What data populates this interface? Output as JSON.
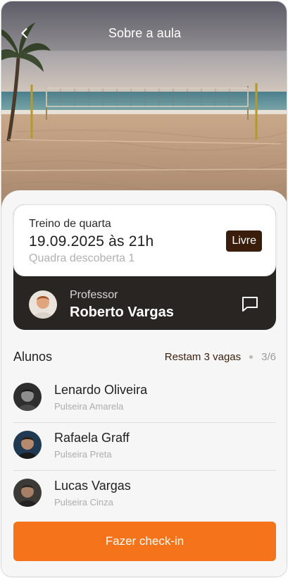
{
  "header": {
    "title": "Sobre a aula",
    "back_icon": "chevron-left-icon"
  },
  "hero_image": "beach-volleyball-court",
  "class_info": {
    "name": "Treino de quarta",
    "datetime": "19.09.2025 às 21h",
    "location": "Quadra descoberta 1",
    "badge": "Livre"
  },
  "professor": {
    "label": "Professor",
    "name": "Roberto Vargas",
    "chat_icon": "chat-icon"
  },
  "students": {
    "title": "Alunos",
    "remaining": "Restam 3 vagas",
    "count": "3/6",
    "items": [
      {
        "name": "Lenardo Oliveira",
        "belt": "Pulseira Amarela"
      },
      {
        "name": "Rafaela Graff",
        "belt": "Pulseira Preta"
      },
      {
        "name": "Lucas Vargas",
        "belt": "Pulseira Cinza"
      }
    ]
  },
  "checkin_label": "Fazer check-in",
  "colors": {
    "accent": "#f4731b",
    "badge": "#3b1d0b",
    "dark_card": "#282523"
  }
}
